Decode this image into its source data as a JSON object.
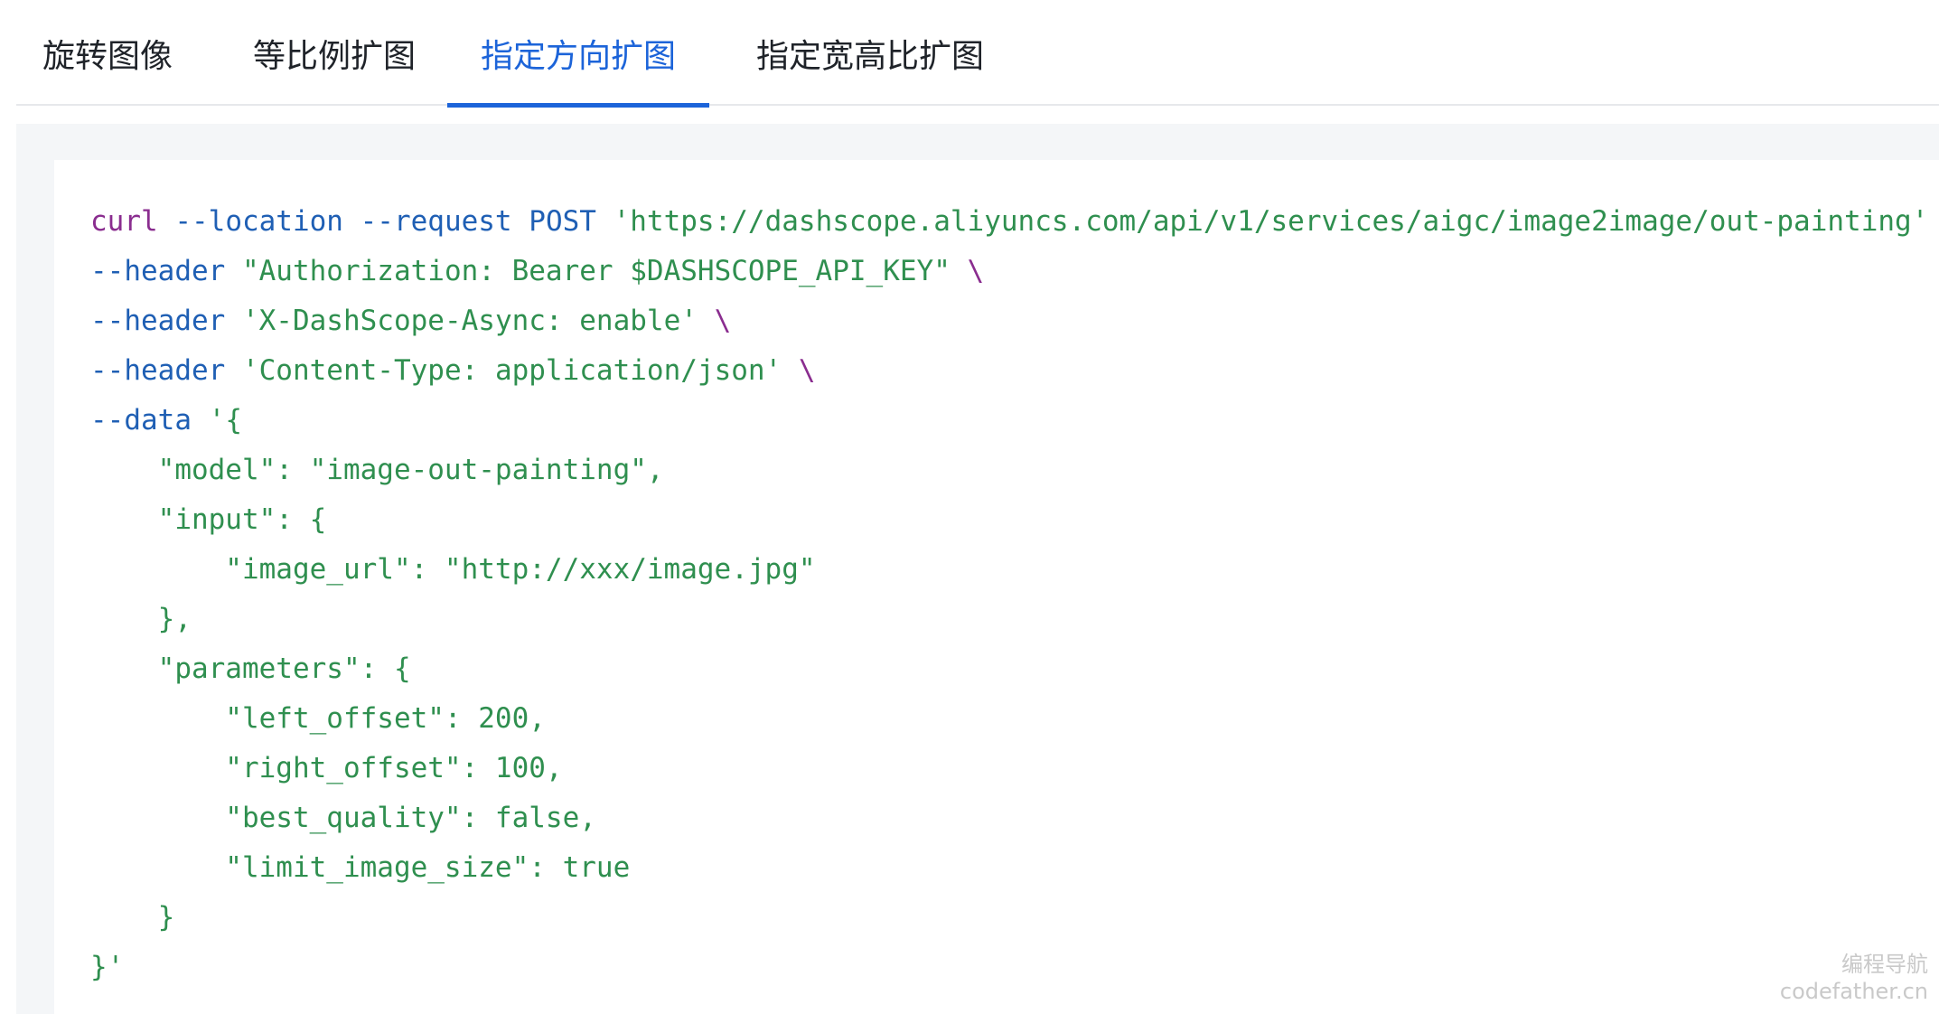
{
  "tabs": [
    {
      "label": "旋转图像",
      "active": false
    },
    {
      "label": "等比例扩图",
      "active": false
    },
    {
      "label": "指定方向扩图",
      "active": true
    },
    {
      "label": "指定宽高比扩图",
      "active": false
    }
  ],
  "code": {
    "l1_cmd": "curl",
    "l1_flags": "--location --request",
    "l1_method": "POST",
    "l1_url": "'https://dashscope.aliyuncs.com/api/v1/services/aigc/image2image/out-painting'",
    "l1_tail": " \\",
    "l2_flag": "--header",
    "l2_val": "\"Authorization: Bearer $DASHSCOPE_API_KEY\"",
    "l3_flag": "--header",
    "l3_val": "'X-DashScope-Async: enable'",
    "l4_flag": "--header",
    "l4_val": "'Content-Type: application/json'",
    "l5_flag": "--data",
    "l5_val": "'{",
    "l6": "    \"model\": \"image-out-painting\",",
    "l7": "    \"input\": {",
    "l8": "        \"image_url\": \"http://xxx/image.jpg\"",
    "l9": "    },",
    "l10": "    \"parameters\": {",
    "l11": "        \"left_offset\": 200,",
    "l12": "        \"right_offset\": 100,",
    "l13": "        \"best_quality\": false,",
    "l14": "        \"limit_image_size\": true",
    "l15": "    }",
    "l16": "}'"
  },
  "watermark": {
    "line1": "编程导航",
    "line2": "codefather.cn"
  },
  "colors": {
    "accent": "#1c64d9",
    "keyword": "#8a2d8f",
    "flag": "#1f5fb4",
    "string": "#2f8f4f"
  }
}
